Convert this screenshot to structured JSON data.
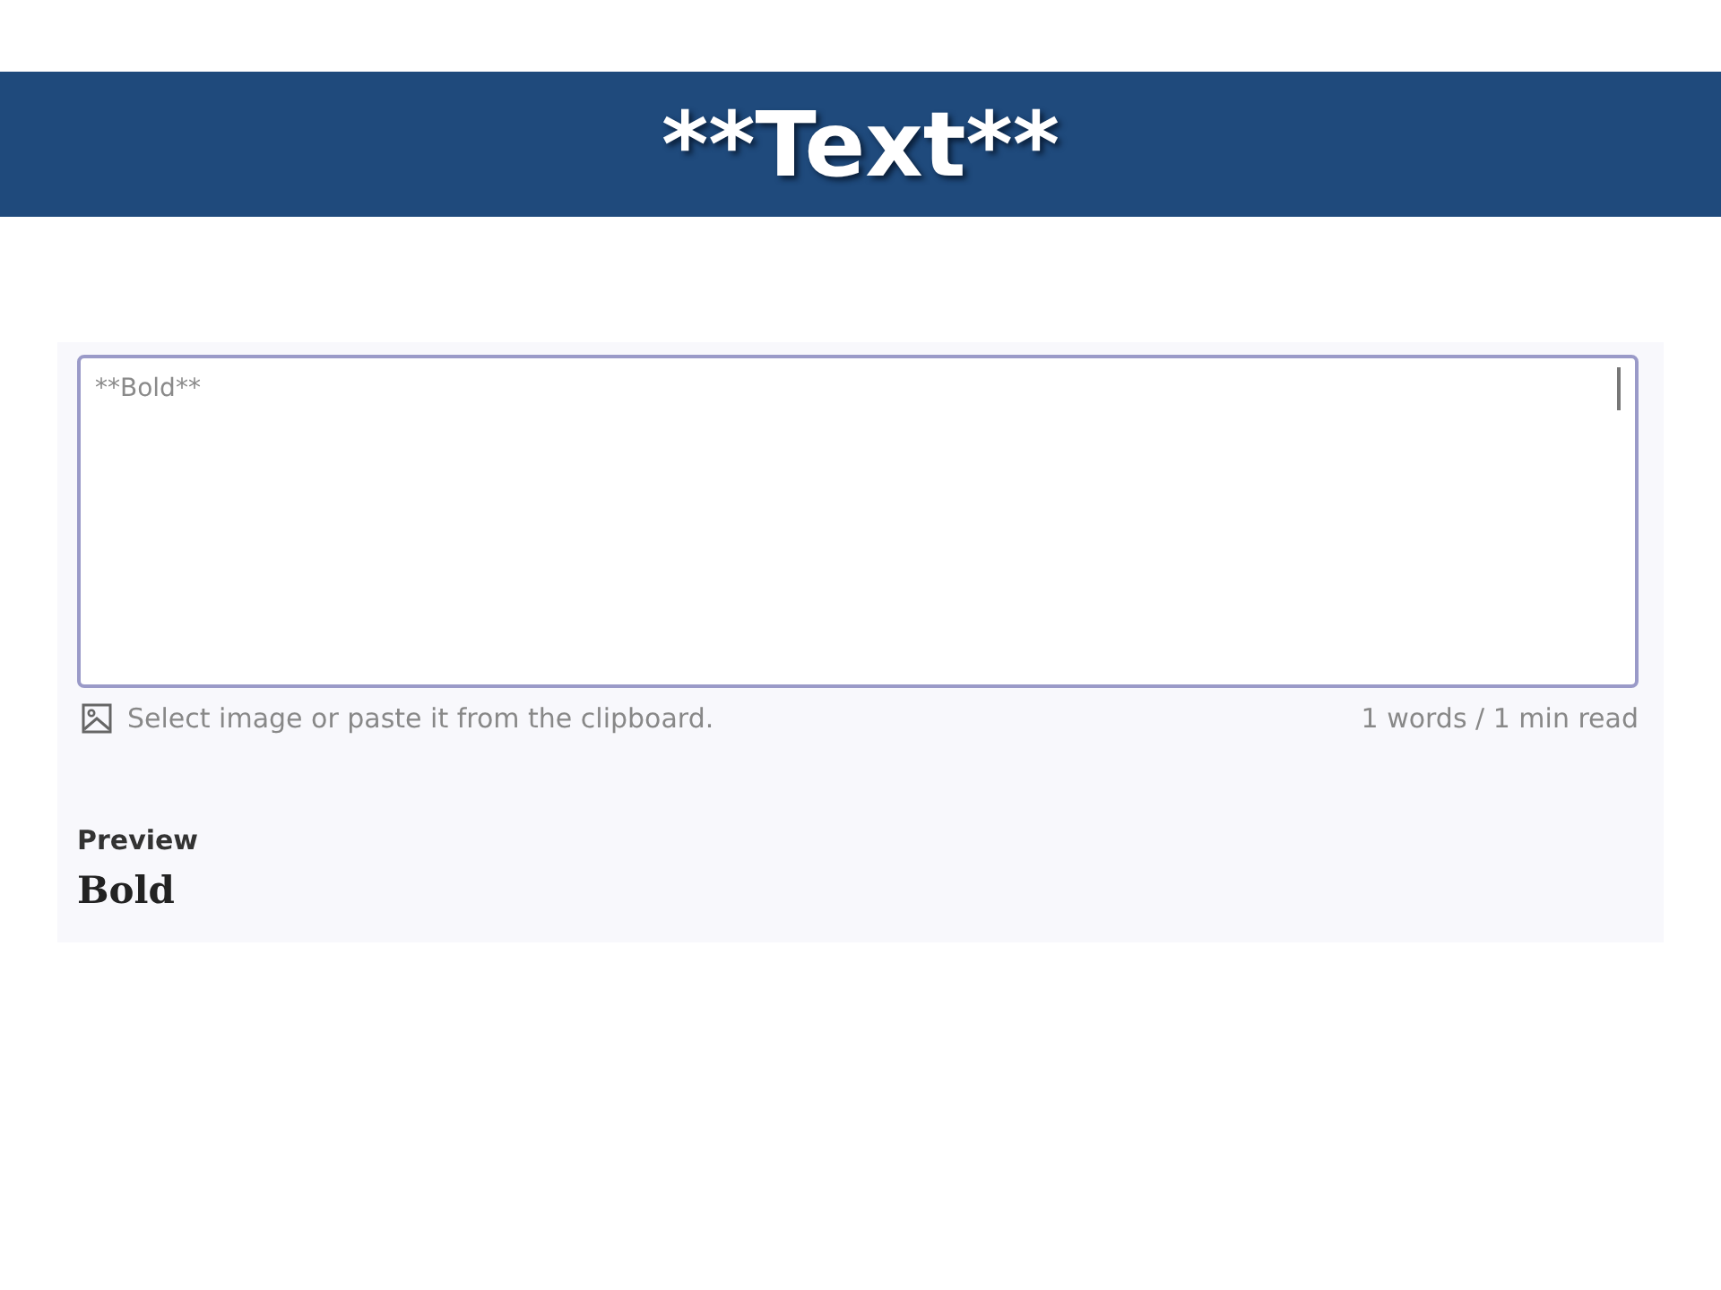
{
  "slide_title": "**Text**",
  "editor": {
    "value": "**Bold**",
    "attach_hint": "Select image or paste it from the clipboard.",
    "word_count": "1 words / 1 min read"
  },
  "preview": {
    "label": "Preview",
    "content": "Bold"
  }
}
